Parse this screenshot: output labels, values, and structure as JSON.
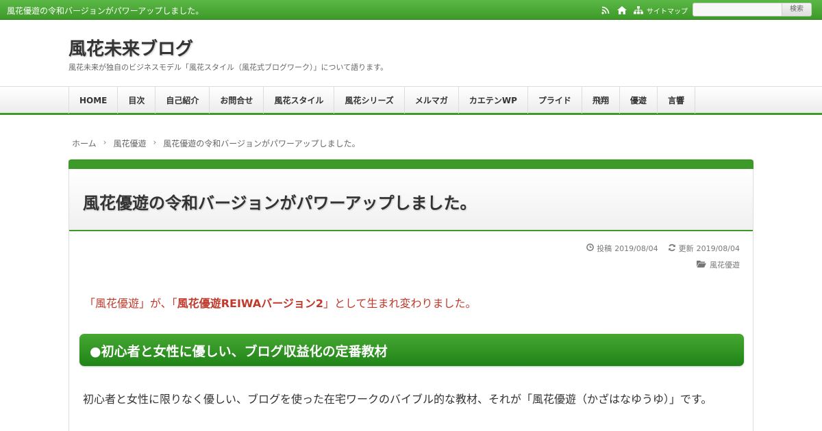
{
  "topbar": {
    "tagline": "風花優遊の令和バージョンがパワーアップしました。",
    "icons": [
      "rss-icon",
      "home-icon",
      "sitemap-icon"
    ],
    "sitemap_label": "サイトマップ",
    "search_placeholder": "",
    "search_button": "検索"
  },
  "header": {
    "site_title": "風花未来ブログ",
    "description": "風花未来が独自のビジネスモデル「風花スタイル（風花式ブログワーク）」について語ります。"
  },
  "nav": {
    "items": [
      "HOME",
      "目次",
      "自己紹介",
      "お問合せ",
      "風花スタイル",
      "風花シリーズ",
      "メルマガ",
      "カエテンWP",
      "プライド",
      "飛翔",
      "優遊",
      "言響"
    ]
  },
  "breadcrumb": {
    "items": [
      "ホーム",
      "風花優遊",
      "風花優遊の令和バージョンがパワーアップしました。"
    ],
    "separator": "›"
  },
  "article": {
    "title": "風花優遊の令和バージョンがパワーアップしました。",
    "posted_label": "投稿",
    "posted_date": "2019/08/04",
    "updated_label": "更新",
    "updated_date": "2019/08/04",
    "category": "風花優遊",
    "lead_prefix": "「風花優遊」が、「",
    "lead_bold": "風花優遊REIWAバージョン2",
    "lead_suffix": "」として生まれ変わりました。",
    "heading": "●初心者と女性に優しい、ブログ収益化の定番教材",
    "paragraph": "初心者と女性に限りなく優しい、ブログを使った在宅ワークのバイブル的な教材、それが「風花優遊（かざはなゆうゆ）」です。"
  },
  "colors": {
    "accent_green": "#3d9a28",
    "lead_red": "#c0392b"
  }
}
